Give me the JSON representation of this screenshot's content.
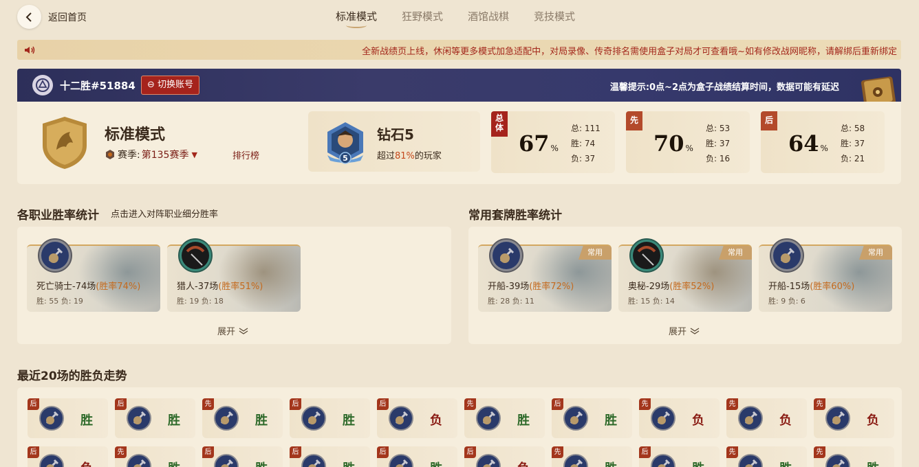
{
  "nav": {
    "back_label": "返回首页",
    "tabs": [
      {
        "label": "标准模式",
        "active": true
      },
      {
        "label": "狂野模式",
        "active": false
      },
      {
        "label": "酒馆战棋",
        "active": false
      },
      {
        "label": "竞技模式",
        "active": false
      }
    ]
  },
  "notice": {
    "text": "全新战绩页上线，休闲等更多模式加急适配中，对局录像、传奇排名需使用盒子对局才可查看哦~如有修改战网昵称，请解绑后重新绑定"
  },
  "account": {
    "name": "十二胜#51884",
    "switch_label": "切换账号",
    "tip": "温馨提示:0点~2点为盒子战绩结算时间，数据可能有延迟"
  },
  "mode": {
    "title": "标准模式",
    "season_label": "赛季:",
    "season_value": "第135赛季",
    "rank_link": "排行榜",
    "rank_name": "钻石5",
    "rank_level": "5",
    "rank_sub_prefix": "超过",
    "rank_sub_pct": "81%",
    "rank_sub_suffix": "的玩家"
  },
  "winrates": [
    {
      "tag": "总体",
      "value": "67",
      "unit": "%",
      "total_label": "总:",
      "total": "111",
      "win_label": "胜:",
      "win": "74",
      "lose_label": "负:",
      "lose": "37"
    },
    {
      "tag": "先",
      "value": "70",
      "unit": "%",
      "total_label": "总:",
      "total": "53",
      "win_label": "胜:",
      "win": "37",
      "lose_label": "负:",
      "lose": "16"
    },
    {
      "tag": "后",
      "value": "64",
      "unit": "%",
      "total_label": "总:",
      "total": "58",
      "win_label": "胜:",
      "win": "37",
      "lose_label": "负:",
      "lose": "21"
    }
  ],
  "class_section": {
    "title": "各职业胜率统计",
    "subtitle": "点击进入对阵职业细分胜率",
    "expand": "展开",
    "cards": [
      {
        "name": "死亡骑士-74场",
        "rate": "(胜率74%)",
        "stats": "胜: 55 负: 19",
        "icon": "death-knight-icon"
      },
      {
        "name": "猎人-37场",
        "rate": "(胜率51%)",
        "stats": "胜: 19 负: 18",
        "icon": "hunter-icon"
      }
    ]
  },
  "deck_section": {
    "title": "常用套牌胜率统计",
    "expand": "展开",
    "common_tag": "常用",
    "cards": [
      {
        "name": "开船-39场",
        "rate": "(胜率72%)",
        "stats": "胜: 28 负: 11",
        "icon": "death-knight-icon"
      },
      {
        "name": "奥秘-29场",
        "rate": "(胜率52%)",
        "stats": "胜: 15 负: 14",
        "icon": "hunter-icon"
      },
      {
        "name": "开船-15场",
        "rate": "(胜率60%)",
        "stats": "胜: 9 负: 6",
        "icon": "death-knight-icon"
      }
    ]
  },
  "recent": {
    "title": "最近20场的胜负走势",
    "row1": [
      {
        "tag": "后",
        "result": "胜",
        "win": true
      },
      {
        "tag": "后",
        "result": "胜",
        "win": true
      },
      {
        "tag": "先",
        "result": "胜",
        "win": true
      },
      {
        "tag": "后",
        "result": "胜",
        "win": true
      },
      {
        "tag": "后",
        "result": "负",
        "win": false
      },
      {
        "tag": "先",
        "result": "胜",
        "win": true
      },
      {
        "tag": "后",
        "result": "胜",
        "win": true
      },
      {
        "tag": "先",
        "result": "负",
        "win": false
      },
      {
        "tag": "先",
        "result": "负",
        "win": false
      },
      {
        "tag": "先",
        "result": "负",
        "win": false
      }
    ],
    "row2": [
      {
        "tag": "后",
        "result": "负",
        "win": false
      },
      {
        "tag": "先",
        "result": "胜",
        "win": true
      },
      {
        "tag": "后",
        "result": "胜",
        "win": true
      },
      {
        "tag": "后",
        "result": "胜",
        "win": true
      },
      {
        "tag": "后",
        "result": "胜",
        "win": true
      },
      {
        "tag": "后",
        "result": "负",
        "win": false
      },
      {
        "tag": "先",
        "result": "胜",
        "win": true
      },
      {
        "tag": "后",
        "result": "胜",
        "win": true
      },
      {
        "tag": "先",
        "result": "胜",
        "win": true
      },
      {
        "tag": "先",
        "result": "胜",
        "win": true
      }
    ]
  },
  "colors": {
    "accent_red": "#a5231c",
    "win_green": "#2e6a2a",
    "lose_red": "#8a1c14",
    "banner_navy": "#2d2f5a",
    "page_bg": "#efe5d2"
  }
}
